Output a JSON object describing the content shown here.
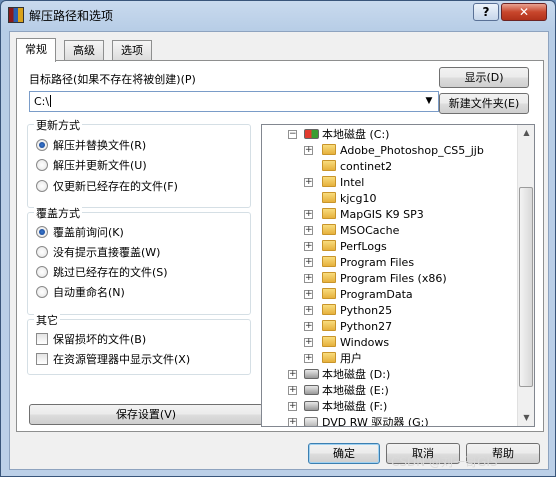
{
  "window": {
    "title": "解压路径和选项",
    "help_label": "?",
    "close_label": "✕"
  },
  "tabs": [
    {
      "label": "常规",
      "active": true
    },
    {
      "label": "高级",
      "active": false
    },
    {
      "label": "选项",
      "active": false
    }
  ],
  "target": {
    "label": "目标路径(如果不存在将被创建)(P)",
    "value": "C:\\",
    "show_button": "显示(D)",
    "new_folder_button": "新建文件夹(E)"
  },
  "update_mode": {
    "title": "更新方式",
    "options": [
      {
        "label": "解压并替换文件(R)",
        "selected": true
      },
      {
        "label": "解压并更新文件(U)",
        "selected": false
      },
      {
        "label": "仅更新已经存在的文件(F)",
        "selected": false
      }
    ]
  },
  "overwrite_mode": {
    "title": "覆盖方式",
    "options": [
      {
        "label": "覆盖前询问(K)",
        "selected": true
      },
      {
        "label": "没有提示直接覆盖(W)",
        "selected": false
      },
      {
        "label": "跳过已经存在的文件(S)",
        "selected": false
      },
      {
        "label": "自动重命名(N)",
        "selected": false
      }
    ]
  },
  "misc": {
    "title": "其它",
    "options": [
      {
        "label": "保留损坏的文件(B)",
        "checked": false
      },
      {
        "label": "在资源管理器中显示文件(X)",
        "checked": false
      }
    ]
  },
  "save_settings_button": "保存设置(V)",
  "tree": {
    "root": "本地磁盘 (C:)",
    "folders": [
      "Adobe_Photoshop_CS5_jjb",
      "continet2",
      "Intel",
      "kjcg10",
      "MapGIS K9 SP3",
      "MSOCache",
      "PerfLogs",
      "Program Files",
      "Program Files (x86)",
      "ProgramData",
      "Python25",
      "Python27",
      "Windows",
      "用户"
    ],
    "drives": [
      "本地磁盘 (D:)",
      "本地磁盘 (E:)",
      "本地磁盘 (F:)",
      "DVD RW 驱动器 (G:)"
    ]
  },
  "footer": {
    "ok": "确定",
    "cancel": "取消",
    "help": "帮助"
  },
  "watermark": "CSDN @刘一哥GIS"
}
